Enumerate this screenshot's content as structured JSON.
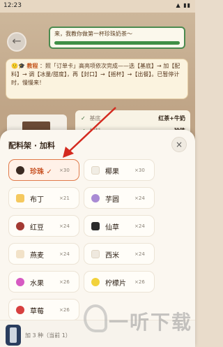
{
  "status_bar": {
    "time": "12:23",
    "icons": "▲ ▮▮"
  },
  "speech": {
    "text": "来，我教你做第一杯珍珠奶茶～"
  },
  "tutorial": {
    "icon": "🙂🎓",
    "label": "教程",
    "text": "：照「订单卡」高亮项依次完成——选【基底】→ 加【配料】→ 调【冰量/甜度】，再【封口】→【摇杯】→【出餐】。已暂停计时，慢慢来！"
  },
  "prep": {
    "rows": [
      {
        "check": "✓",
        "label": "基底",
        "value": "红茶+牛奶"
      },
      {
        "check": "✓",
        "label": "加料",
        "value": "珍珠"
      }
    ]
  },
  "sheet": {
    "title": "配料架 · 加料",
    "close": "×",
    "items": [
      {
        "label": "珍珠 ✓",
        "count": "×30",
        "color": "#3b2a22",
        "shape": "round"
      },
      {
        "label": "椰果",
        "count": "×30",
        "color": "#f1ede4",
        "shape": "square"
      },
      {
        "label": "布丁",
        "count": "×21",
        "color": "#f5c95f",
        "shape": "square"
      },
      {
        "label": "芋圆",
        "count": "×24",
        "color": "#a98bd4",
        "shape": "round"
      },
      {
        "label": "红豆",
        "count": "×24",
        "color": "#a33a32",
        "shape": "round"
      },
      {
        "label": "仙草",
        "count": "×24",
        "color": "#2b2b2b",
        "shape": "square"
      },
      {
        "label": "燕麦",
        "count": "×24",
        "color": "#f2e2c8",
        "shape": "square"
      },
      {
        "label": "西米",
        "count": "×24",
        "color": "#efe9df",
        "shape": "square"
      },
      {
        "label": "水果",
        "count": "×26",
        "color": "#d65ac2",
        "shape": "round"
      },
      {
        "label": "柠檬片",
        "count": "×26",
        "color": "#f2d23b",
        "shape": "round"
      },
      {
        "label": "草莓",
        "count": "×26",
        "color": "#d7403f",
        "shape": "round"
      }
    ],
    "footer": "加 3 种（当前 1）"
  },
  "watermark": {
    "text": "一听下载"
  },
  "colors": {
    "accent": "#e07a4a",
    "progress": "#3f8f46"
  }
}
